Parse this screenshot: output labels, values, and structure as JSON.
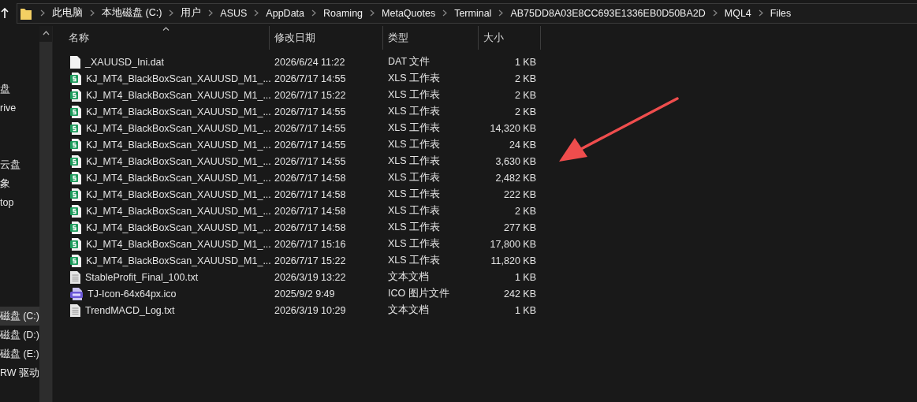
{
  "address_bar": {
    "path": [
      "此电脑",
      "本地磁盘 (C:)",
      "用户",
      "ASUS",
      "AppData",
      "Roaming",
      "MetaQuotes",
      "Terminal",
      "AB75DD8A03E8CC693E1336EB0D50BA2D",
      "MQL4",
      "Files"
    ]
  },
  "sidebar": {
    "items": [
      {
        "label": "盘",
        "selected": false
      },
      {
        "label": "rive",
        "selected": false
      },
      {
        "label": "云盘",
        "selected": false
      },
      {
        "label": "象",
        "selected": false
      },
      {
        "label": "top",
        "selected": false
      },
      {
        "label": "磁盘 (C:)",
        "selected": true
      },
      {
        "label": "磁盘 (D:)",
        "selected": false
      },
      {
        "label": "磁盘 (E:)",
        "selected": false
      },
      {
        "label": "RW 驱动",
        "selected": false
      }
    ]
  },
  "table": {
    "columns": [
      "名称",
      "修改日期",
      "类型",
      "大小"
    ],
    "rows": [
      {
        "kind": "file",
        "name": "_XAUUSD_Ini.dat",
        "date": "2026/6/24 11:22",
        "type": "DAT 文件",
        "size": "1 KB"
      },
      {
        "kind": "sheet",
        "name": "KJ_MT4_BlackBoxScan_XAUUSD_M1_...",
        "date": "2026/7/17 14:55",
        "type": "XLS 工作表",
        "size": "2 KB"
      },
      {
        "kind": "sheet",
        "name": "KJ_MT4_BlackBoxScan_XAUUSD_M1_...",
        "date": "2026/7/17 15:22",
        "type": "XLS 工作表",
        "size": "2 KB"
      },
      {
        "kind": "sheet",
        "name": "KJ_MT4_BlackBoxScan_XAUUSD_M1_...",
        "date": "2026/7/17 14:55",
        "type": "XLS 工作表",
        "size": "2 KB"
      },
      {
        "kind": "sheet",
        "name": "KJ_MT4_BlackBoxScan_XAUUSD_M1_...",
        "date": "2026/7/17 14:55",
        "type": "XLS 工作表",
        "size": "14,320 KB"
      },
      {
        "kind": "sheet",
        "name": "KJ_MT4_BlackBoxScan_XAUUSD_M1_...",
        "date": "2026/7/17 14:55",
        "type": "XLS 工作表",
        "size": "24 KB"
      },
      {
        "kind": "sheet",
        "name": "KJ_MT4_BlackBoxScan_XAUUSD_M1_...",
        "date": "2026/7/17 14:55",
        "type": "XLS 工作表",
        "size": "3,630 KB"
      },
      {
        "kind": "sheet",
        "name": "KJ_MT4_BlackBoxScan_XAUUSD_M1_...",
        "date": "2026/7/17 14:58",
        "type": "XLS 工作表",
        "size": "2,482 KB"
      },
      {
        "kind": "sheet",
        "name": "KJ_MT4_BlackBoxScan_XAUUSD_M1_...",
        "date": "2026/7/17 14:58",
        "type": "XLS 工作表",
        "size": "222 KB"
      },
      {
        "kind": "sheet",
        "name": "KJ_MT4_BlackBoxScan_XAUUSD_M1_...",
        "date": "2026/7/17 14:58",
        "type": "XLS 工作表",
        "size": "2 KB"
      },
      {
        "kind": "sheet",
        "name": "KJ_MT4_BlackBoxScan_XAUUSD_M1_...",
        "date": "2026/7/17 14:58",
        "type": "XLS 工作表",
        "size": "277 KB"
      },
      {
        "kind": "sheet",
        "name": "KJ_MT4_BlackBoxScan_XAUUSD_M1_...",
        "date": "2026/7/17 15:16",
        "type": "XLS 工作表",
        "size": "17,800 KB"
      },
      {
        "kind": "sheet",
        "name": "KJ_MT4_BlackBoxScan_XAUUSD_M1_...",
        "date": "2026/7/17 15:22",
        "type": "XLS 工作表",
        "size": "11,820 KB"
      },
      {
        "kind": "text",
        "name": "StableProfit_Final_100.txt",
        "date": "2026/3/19 13:22",
        "type": "文本文档",
        "size": "1 KB"
      },
      {
        "kind": "image",
        "name": "TJ-Icon-64x64px.ico",
        "date": "2025/9/2 9:49",
        "type": "ICO 图片文件",
        "size": "242 KB"
      },
      {
        "kind": "text",
        "name": "TrendMACD_Log.txt",
        "date": "2026/3/19 10:29",
        "type": "文本文档",
        "size": "1 KB"
      }
    ]
  }
}
